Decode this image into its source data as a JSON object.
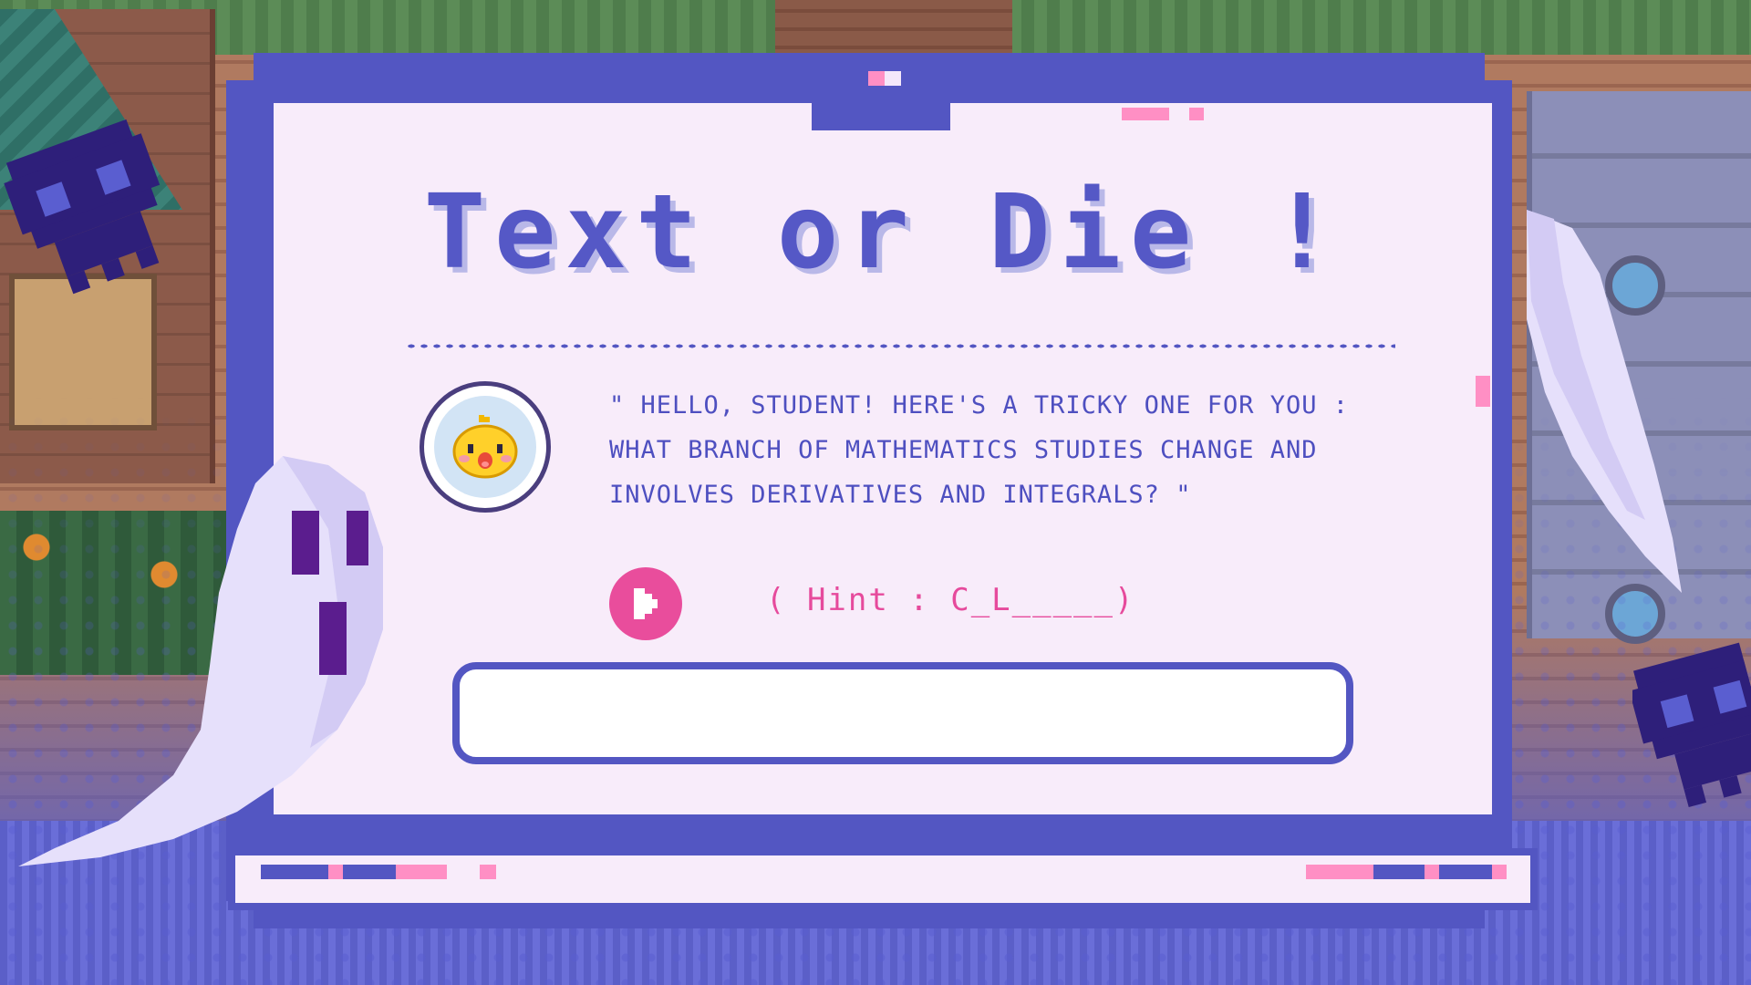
{
  "title": "Text or Die !",
  "question": {
    "line1": "\" HELLO, STUDENT! HERE'S A TRICKY ONE FOR YOU :",
    "line2": "WHAT BRANCH OF MATHEMATICS STUDIES CHANGE AND",
    "line3": "INVOLVES DERIVATIVES AND INTEGRALS? \""
  },
  "hint": "( Hint : C_L_____)",
  "answer": {
    "value": "",
    "placeholder": ""
  },
  "icons": {
    "avatar": "chick-face-icon",
    "play": "play-icon",
    "ghost": "ghost-icon",
    "skull": "pixel-skull-icon"
  },
  "colors": {
    "frame": "#5356c2",
    "panel": "#f8ecfa",
    "accent_pink": "#e94d9c",
    "text_blue": "#4e4fc0"
  }
}
